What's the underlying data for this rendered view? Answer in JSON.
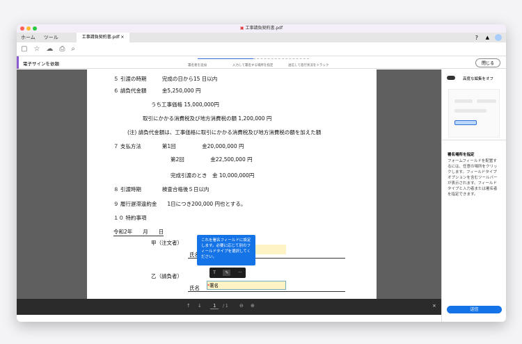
{
  "window": {
    "title": "工事請負契約書.pdf"
  },
  "tabs": {
    "home": "ホーム",
    "tools": "ツール",
    "doc": "工事請負契約書.pdf",
    "close": "×"
  },
  "signbar": {
    "title": "電子サインを依頼",
    "steps": [
      "署名者を追加",
      "入力して署名する場所を指定",
      "送信して進行状況をトラック"
    ],
    "close": "閉じる"
  },
  "document": {
    "lines": [
      "５ 引渡の時期　　　完成の日から15 日以内",
      "６ 請負代金額　　　金5,250,000 円",
      "うち工事価格 15,000,000円",
      "取引にかかる消費税及び地方消費税の額 1,200,000 円",
      "(注) 請負代金額は、工事価格に取引にかかる消費税及び地方消費税の額を加えた額",
      "７ 支払方法　　　　第1回　　　　　金20,000,000 円",
      "第2回　　　　　金22,500,000 円",
      "完成引渡のとき　金 10,000,000円",
      "８ 引渡時期　　　　検査合格後５日以内",
      "９ 履行遅滞違約金　　1日につき200,000 円也とする。",
      "１０ 特約事項",
      "令和2年　　月　　日",
      "甲（注文者）",
      "氏名",
      "乙（請負者）",
      "氏名"
    ],
    "field_label": "署名",
    "tooltip": "これを署名フィールドに設定します。必要に応じて別のフィールドタイプを選択してください。",
    "field_tools": [
      "T",
      "✎",
      "···"
    ]
  },
  "pager": {
    "current": "1",
    "total": "/ 1"
  },
  "panel": {
    "toggle_label": "高度な編集をオフ",
    "heading": "署名場所を指定",
    "body": "フォームフィールドを配置するには、任意の場所をクリックします。フィールドタイプオプションを含むツールバーが表示されます。フィールドタイプと入力者または署名者を指定できます。",
    "send": "送信"
  }
}
